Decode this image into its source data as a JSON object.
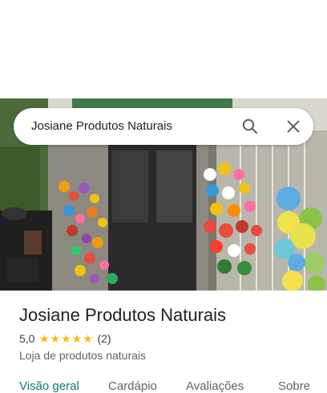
{
  "search": {
    "query": "Josiane Produtos Naturais"
  },
  "place": {
    "name": "Josiane Produtos Naturais",
    "rating": "5,0",
    "stars": 5,
    "review_count": "(2)",
    "category": "Loja de produtos naturais"
  },
  "tabs": [
    {
      "label": "Visão geral",
      "active": true
    },
    {
      "label": "Cardápio"
    },
    {
      "label": "Avaliações"
    },
    {
      "label": "Sobre"
    }
  ],
  "colors": {
    "active_tab": "#0b7a75",
    "star": "#fbbc04"
  }
}
